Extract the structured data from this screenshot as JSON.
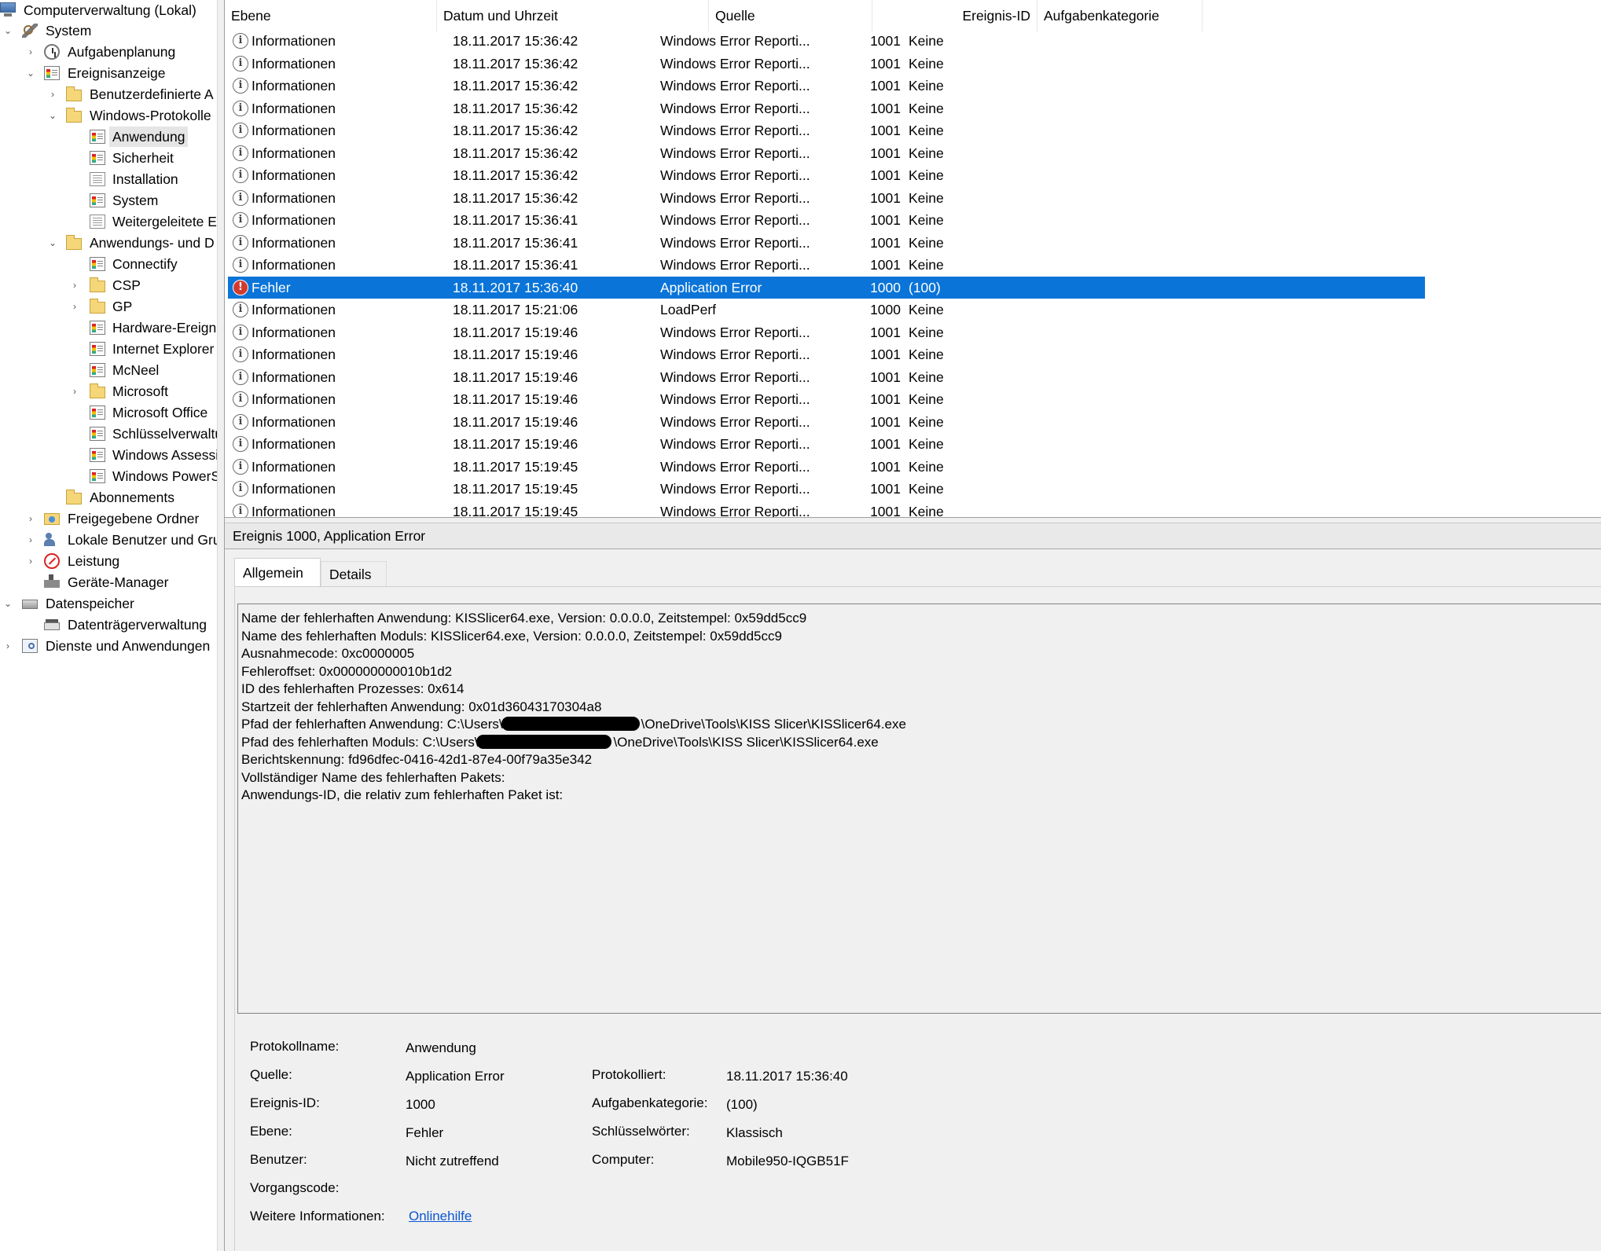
{
  "tree": {
    "root": "Computerverwaltung (Lokal)",
    "system": "System",
    "task_scheduler": "Aufgabenplanung",
    "event_viewer": "Ereignisanzeige",
    "custom_views": "Benutzerdefinierte A",
    "windows_logs": "Windows-Protokolle",
    "log_application": "Anwendung",
    "log_security": "Sicherheit",
    "log_installation": "Installation",
    "log_system": "System",
    "log_forwarded": "Weitergeleitete E",
    "apps_services": "Anwendungs- und D",
    "connectify": "Connectify",
    "csp": "CSP",
    "gp": "GP",
    "hardware_events": "Hardware-Ereign",
    "internet_explorer": "Internet Explorer",
    "mcneel": "McNeel",
    "microsoft": "Microsoft",
    "microsoft_office": "Microsoft Office",
    "key_management": "Schlüsselverwaltu",
    "windows_assessment": "Windows Assessi",
    "windows_powershell": "Windows PowerS",
    "subscriptions": "Abonnements",
    "shared_folders": "Freigegebene Ordner",
    "local_users": "Lokale Benutzer und Gru",
    "performance": "Leistung",
    "device_manager": "Geräte-Manager",
    "storage": "Datenspeicher",
    "disk_management": "Datenträgerverwaltung",
    "services_apps": "Dienste und Anwendungen"
  },
  "list": {
    "headers": {
      "level": "Ebene",
      "datetime": "Datum und Uhrzeit",
      "source": "Quelle",
      "event_id": "Ereignis-ID",
      "category": "Aufgabenkategorie"
    },
    "rows": [
      {
        "level": "Informationen",
        "datetime": "18.11.2017 15:36:42",
        "source": "Windows Error Reporti...",
        "id": "1001",
        "category": "Keine"
      },
      {
        "level": "Informationen",
        "datetime": "18.11.2017 15:36:42",
        "source": "Windows Error Reporti...",
        "id": "1001",
        "category": "Keine"
      },
      {
        "level": "Informationen",
        "datetime": "18.11.2017 15:36:42",
        "source": "Windows Error Reporti...",
        "id": "1001",
        "category": "Keine"
      },
      {
        "level": "Informationen",
        "datetime": "18.11.2017 15:36:42",
        "source": "Windows Error Reporti...",
        "id": "1001",
        "category": "Keine"
      },
      {
        "level": "Informationen",
        "datetime": "18.11.2017 15:36:42",
        "source": "Windows Error Reporti...",
        "id": "1001",
        "category": "Keine"
      },
      {
        "level": "Informationen",
        "datetime": "18.11.2017 15:36:42",
        "source": "Windows Error Reporti...",
        "id": "1001",
        "category": "Keine"
      },
      {
        "level": "Informationen",
        "datetime": "18.11.2017 15:36:42",
        "source": "Windows Error Reporti...",
        "id": "1001",
        "category": "Keine"
      },
      {
        "level": "Informationen",
        "datetime": "18.11.2017 15:36:42",
        "source": "Windows Error Reporti...",
        "id": "1001",
        "category": "Keine"
      },
      {
        "level": "Informationen",
        "datetime": "18.11.2017 15:36:41",
        "source": "Windows Error Reporti...",
        "id": "1001",
        "category": "Keine"
      },
      {
        "level": "Informationen",
        "datetime": "18.11.2017 15:36:41",
        "source": "Windows Error Reporti...",
        "id": "1001",
        "category": "Keine"
      },
      {
        "level": "Informationen",
        "datetime": "18.11.2017 15:36:41",
        "source": "Windows Error Reporti...",
        "id": "1001",
        "category": "Keine"
      },
      {
        "level": "Fehler",
        "datetime": "18.11.2017 15:36:40",
        "source": "Application Error",
        "id": "1000",
        "category": "(100)"
      },
      {
        "level": "Informationen",
        "datetime": "18.11.2017 15:21:06",
        "source": "LoadPerf",
        "id": "1000",
        "category": "Keine"
      },
      {
        "level": "Informationen",
        "datetime": "18.11.2017 15:19:46",
        "source": "Windows Error Reporti...",
        "id": "1001",
        "category": "Keine"
      },
      {
        "level": "Informationen",
        "datetime": "18.11.2017 15:19:46",
        "source": "Windows Error Reporti...",
        "id": "1001",
        "category": "Keine"
      },
      {
        "level": "Informationen",
        "datetime": "18.11.2017 15:19:46",
        "source": "Windows Error Reporti...",
        "id": "1001",
        "category": "Keine"
      },
      {
        "level": "Informationen",
        "datetime": "18.11.2017 15:19:46",
        "source": "Windows Error Reporti...",
        "id": "1001",
        "category": "Keine"
      },
      {
        "level": "Informationen",
        "datetime": "18.11.2017 15:19:46",
        "source": "Windows Error Reporti...",
        "id": "1001",
        "category": "Keine"
      },
      {
        "level": "Informationen",
        "datetime": "18.11.2017 15:19:46",
        "source": "Windows Error Reporti...",
        "id": "1001",
        "category": "Keine"
      },
      {
        "level": "Informationen",
        "datetime": "18.11.2017 15:19:45",
        "source": "Windows Error Reporti...",
        "id": "1001",
        "category": "Keine"
      },
      {
        "level": "Informationen",
        "datetime": "18.11.2017 15:19:45",
        "source": "Windows Error Reporti...",
        "id": "1001",
        "category": "Keine"
      },
      {
        "level": "Informationen",
        "datetime": "18.11.2017 15:19:45",
        "source": "Windows Error Reporti...",
        "id": "1001",
        "category": "Keine"
      }
    ]
  },
  "detail": {
    "title": "Ereignis 1000, Application Error",
    "tab_general": "Allgemein",
    "tab_details": "Details",
    "message": {
      "l1": "Name der fehlerhaften Anwendung: KISSlicer64.exe, Version: 0.0.0.0, Zeitstempel: 0x59dd5cc9",
      "l2": "Name des fehlerhaften Moduls: KISSlicer64.exe, Version: 0.0.0.0, Zeitstempel: 0x59dd5cc9",
      "l3": "Ausnahmecode: 0xc0000005",
      "l4": "Fehleroffset: 0x000000000010b1d2",
      "l5": "ID des fehlerhaften Prozesses: 0x614",
      "l6": "Startzeit der fehlerhaften Anwendung: 0x01d36043170304a8",
      "l7_prefix": "Pfad der fehlerhaften Anwendung: C:\\Users\\",
      "l7_suffix": "\\OneDrive\\Tools\\KISS Slicer\\KISSlicer64.exe",
      "l8_prefix": "Pfad des fehlerhaften Moduls: C:\\Users\\",
      "l8_suffix": "\\OneDrive\\Tools\\KISS Slicer\\KISSlicer64.exe",
      "l9": "Berichtskennung: fd96dfec-0416-42d1-87e4-00f79a35e342",
      "l10": "Vollständiger Name des fehlerhaften Pakets:",
      "l11": "Anwendungs-ID, die relativ zum fehlerhaften Paket ist:"
    },
    "props": {
      "log_name_label": "Protokollname:",
      "log_name": "Anwendung",
      "source_label": "Quelle:",
      "source": "Application Error",
      "logged_label": "Protokolliert:",
      "logged": "18.11.2017 15:36:40",
      "event_id_label": "Ereignis-ID:",
      "event_id": "1000",
      "task_cat_label": "Aufgabenkategorie:",
      "task_cat": "(100)",
      "level_label": "Ebene:",
      "level": "Fehler",
      "keywords_label": "Schlüsselwörter:",
      "keywords": "Klassisch",
      "user_label": "Benutzer:",
      "user": "Nicht zutreffend",
      "computer_label": "Computer:",
      "computer": "Mobile950-IQGB51F",
      "opcode_label": "Vorgangscode:",
      "more_info_label": "Weitere Informationen:",
      "more_info_link": "Onlinehilfe"
    }
  },
  "colors": {
    "selection": "#0a74d8",
    "error_icon": "#d23a2f",
    "link": "#0b57d0"
  }
}
